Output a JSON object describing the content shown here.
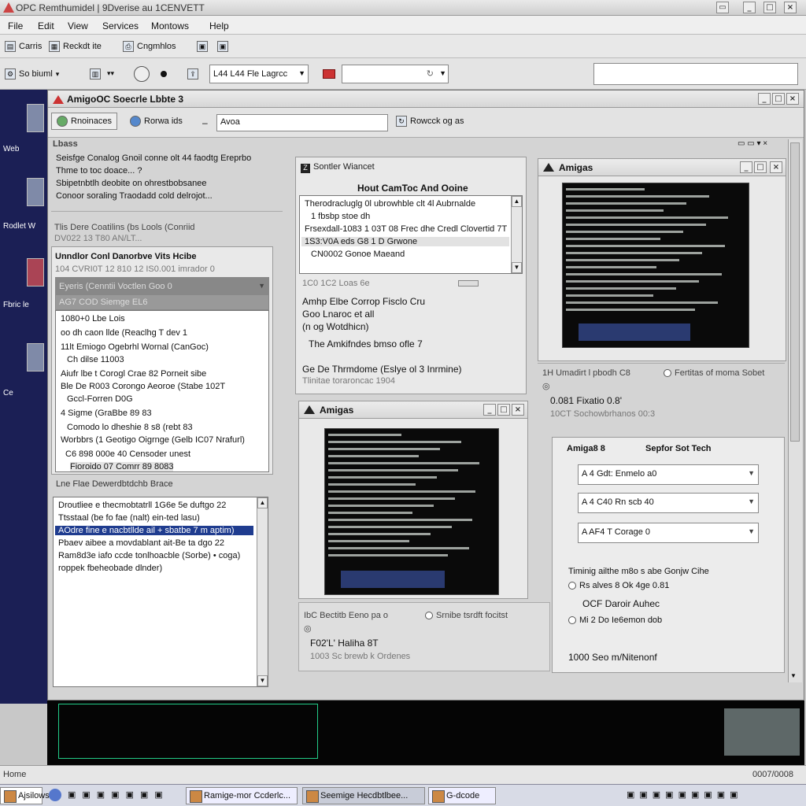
{
  "app": {
    "title": "OPC Remthumidel | 9Dverise au 1CENVETT",
    "menu": [
      "File",
      "Edit",
      "View",
      "Services",
      "Montows",
      "Help"
    ]
  },
  "toolbar1": {
    "items": [
      "Carris",
      "Reckdt ite",
      "Cngmhlos"
    ]
  },
  "toolbar2": {
    "left_label": "So biuml",
    "dropdown_value": "L44 L44 Fle Lagrcc",
    "search_value": ""
  },
  "desktop": {
    "labels": [
      "Web",
      "Rodlet W",
      "Fbric le",
      "Ce"
    ]
  },
  "main_window": {
    "title": "AmigoOC Soecrle Lbbte 3",
    "tools": {
      "btn1": "Rnoinaces",
      "btn2": "Rorwa ids",
      "field_value": "Avoa",
      "btn3": "Rowcck og as"
    }
  },
  "left_panel": {
    "header": "Lbass",
    "items": [
      "Seisfge Conalog Gnoil conne olt 44 faodtg Ereprbo",
      "Thme to toc doace... ?",
      "Sbipetnbtlh deobite on ohrestbobsanee",
      "Conoor soraling Traodadd cold delrojot..."
    ],
    "section_label": "Tlis Dere Coatilins (bs Lools (Conriid",
    "section_sub": "DV022 13 T80 AN/LT...",
    "inner_title": "Unndlor Conl Danorbve Vits Hcibe",
    "inner_sub": "104 CVRI0T 12 810 12 IS0.001 imrador 0",
    "combo1": "Eyeris (Cenntii Voctlen Goo 0",
    "combo2": "AG7 COD Siemge EL6",
    "list_items": [
      "1080+0 Lbe Lois",
      "oo dh caon llde (Reaclhg T dev 1",
      "11lt Emiogo Ogebrhl Wornal (CanGoc)",
      "Ch dilse 11003",
      "Aiufr lbe t Corogl Crae 82 Porneit sibe",
      "Ble De R003 Corongo Aeoroe (Stabe 102T",
      "Gccl-Forren D0G",
      "4 Sigme (GraBbe 89 83",
      "Comodo lo dheshie 8 s8 (rebt 83",
      "Worbbrs (1 Geotigo Oigrnge (Gelb IC07 Nrafurl)",
      "C6 898 000e 40 Censoder unest",
      "Fioroido 07 Comrr 89 8083"
    ],
    "footer_label": "Lne Flae Dewerdbtdchb Brace",
    "bottom_list": [
      "Droutliee e thecmobtatrll 1G6e 5e duftgo 22",
      "Ttsstaal (be fo fae (nalt) ein-ted lasu)",
      "AOdre fine e nacbtllde ail + sbatbe 7 m aptim)",
      "Pbaev aibee a movdablant ait-Be ta dgo 22",
      "Ram8d3e iafo ccde tonlhoacble (Sorbe) • coga)",
      "roppek fbeheobade dlnder)"
    ]
  },
  "center_panel": {
    "title": "Sontler Wiancet",
    "list_header": "Hout CamToc And Ooine",
    "rows": [
      "Therodracluglg 0l ubrowhble clt 4l Aubrnalde",
      "1 fbsbp stoe dh",
      "Frsexdall-1083 1 03T 08 Frec dhe Credl Clovertid 7T",
      "1S3:V0A eds G8 1 D Grwone",
      "CN0002 Gonoe Maeand"
    ],
    "footer_left": "1C0 1C2 Loas 6e",
    "para1": "Amhp Elbe Corrop Fisclo Cru",
    "para2": "Goo Lnaroc et all",
    "para3": "(n og Wotdhicn)",
    "para4": "The Amkifndes bmso ofle 7",
    "para5": "Ge De Thrmdome (Eslye ol 3 Inrmine)",
    "para6": "Tlinitae toraroncac 1904"
  },
  "amigas_win_mid": {
    "title": "Amigas",
    "footer_left": "IbC Bectitb Eeno pa o",
    "footer_right": "Srnibe tsrdft focitst",
    "line1": "F02'L' Haliha 8T",
    "line2": "1003 Sc brewb k Ordenes"
  },
  "amigas_win_right": {
    "title": "Amigas",
    "info_left": "1H Umadirt l pbodh C8",
    "info_right": "Fertitas of moma Sobet",
    "line1": "0.081 Fixatio 0.8'",
    "line2": "10CT Sochowbrhanos 00:3"
  },
  "settings_panel": {
    "heading_left": "Amiga8 8",
    "heading_right": "Sepfor Sot Tech",
    "combos": [
      "A 4 Gdt: Enmelo a0",
      "A 4 C40 Rn scb 40",
      "A AF4 T Corage 0"
    ],
    "note": "Timinig ailthe m8o s abe Gonjw Cihe",
    "radio1": "Rs alves 8 Ok 4ge 0.81",
    "mid_text": "OCF Daroir Auhec",
    "radio2": "Mi 2 Do Ie6emon dob",
    "footer_text": "1000 Seo m/Nitenonf"
  },
  "statusbar": {
    "left": "Home",
    "right": "0007/0008"
  },
  "taskbar": {
    "start": "Ajsilows",
    "tasks": [
      "Ramige-mor Ccderlc...",
      "Seemige Hecdbtlbee...",
      "G-dcode"
    ]
  }
}
